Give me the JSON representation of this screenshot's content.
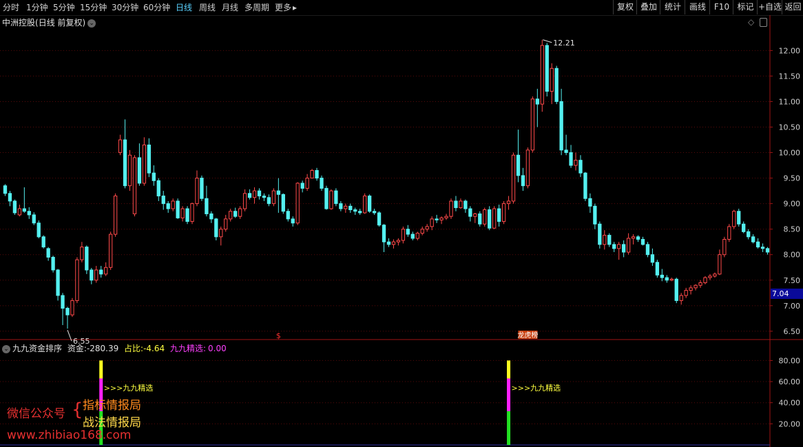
{
  "toolbar": {
    "tabs": [
      "分时",
      "1分钟",
      "5分钟",
      "15分钟",
      "30分钟",
      "60分钟",
      "日线",
      "周线",
      "月线",
      "多周期",
      "更多"
    ],
    "active_tab": "日线",
    "right_buttons": [
      "复权",
      "叠加",
      "统计",
      "画线",
      "F10",
      "标记",
      "+自选",
      "返回"
    ]
  },
  "chart_header": {
    "stock_name": "中洲控股",
    "period": "(日线 前复权)"
  },
  "indicator_header": {
    "name": "九九资金排序",
    "fund_label": "资金:",
    "fund_value": "-280.39",
    "ratio_label": "占比:",
    "ratio_value": "-4.64",
    "select_label": "九九精选:",
    "select_value": "0.00"
  },
  "price_marker": "7.04",
  "markers": {
    "dollar": "$",
    "rank": "龙虎榜",
    "signal": ">>>九九精选"
  },
  "watermark": {
    "line1": "微信公众号",
    "line2a": "指标情报局",
    "line2b": "战法情报局",
    "url": "www.zhibiao168.com"
  },
  "colors": {
    "up": "#ff4a4a",
    "down": "#54f0f0",
    "axis": "#a01414",
    "grid": "#5a0a0a"
  },
  "chart_data": [
    {
      "type": "candlestick",
      "title": "中洲控股(日线 前复权)",
      "y_axis_ticks": [
        "12.00",
        "11.50",
        "11.00",
        "10.50",
        "10.00",
        "9.50",
        "9.00",
        "8.50",
        "8.00",
        "7.50",
        "7.00",
        "6.50"
      ],
      "ylim": [
        6.35,
        12.45
      ],
      "annotations": [
        {
          "label": "12.21",
          "value": 12.21
        },
        {
          "label": "6.55",
          "value": 6.55
        }
      ],
      "ohlc": [
        [
          9.35,
          9.38,
          9.15,
          9.2
        ],
        [
          9.2,
          9.25,
          8.95,
          9.05
        ],
        [
          9.05,
          9.08,
          8.78,
          8.82
        ],
        [
          8.78,
          8.98,
          8.75,
          8.9
        ],
        [
          8.9,
          9.32,
          8.82,
          8.85
        ],
        [
          8.85,
          8.93,
          8.7,
          8.78
        ],
        [
          8.78,
          8.83,
          8.58,
          8.62
        ],
        [
          8.62,
          8.67,
          8.32,
          8.35
        ],
        [
          8.35,
          8.38,
          8.12,
          8.15
        ],
        [
          8.12,
          8.15,
          7.88,
          7.95
        ],
        [
          7.95,
          7.98,
          7.65,
          7.7
        ],
        [
          7.7,
          7.72,
          7.1,
          7.2
        ],
        [
          7.2,
          7.25,
          6.62,
          6.95
        ],
        [
          6.95,
          6.98,
          6.55,
          6.82
        ],
        [
          6.82,
          7.15,
          6.78,
          7.1
        ],
        [
          7.1,
          7.95,
          7.05,
          7.9
        ],
        [
          7.9,
          8.25,
          7.85,
          8.15
        ],
        [
          8.15,
          8.18,
          7.62,
          7.7
        ],
        [
          7.7,
          7.74,
          7.42,
          7.5
        ],
        [
          7.5,
          7.78,
          7.45,
          7.7
        ],
        [
          7.7,
          7.78,
          7.55,
          7.62
        ],
        [
          7.62,
          7.85,
          7.58,
          7.75
        ],
        [
          7.75,
          8.45,
          7.7,
          8.4
        ],
        [
          8.4,
          9.2,
          8.35,
          9.15
        ],
        [
          10.0,
          10.35,
          9.95,
          10.25
        ],
        [
          10.25,
          10.65,
          9.3,
          9.35
        ],
        [
          9.35,
          10.05,
          9.25,
          9.95
        ],
        [
          8.8,
          9.95,
          8.75,
          9.9
        ],
        [
          9.9,
          10.18,
          9.35,
          9.4
        ],
        [
          9.4,
          10.3,
          9.35,
          10.15
        ],
        [
          10.15,
          10.28,
          9.52,
          9.6
        ],
        [
          9.6,
          9.75,
          9.35,
          9.45
        ],
        [
          9.45,
          9.5,
          9.05,
          9.15
        ],
        [
          9.15,
          9.25,
          8.88,
          9.0
        ],
        [
          9.0,
          9.05,
          8.82,
          8.9
        ],
        [
          8.9,
          9.1,
          8.85,
          9.05
        ],
        [
          9.05,
          9.1,
          8.7,
          8.72
        ],
        [
          8.72,
          8.95,
          8.65,
          8.9
        ],
        [
          8.9,
          8.95,
          8.6,
          8.65
        ],
        [
          8.65,
          9.02,
          8.6,
          9.0
        ],
        [
          9.0,
          9.65,
          8.95,
          9.5
        ],
        [
          9.5,
          9.55,
          9.05,
          9.1
        ],
        [
          9.1,
          9.35,
          8.75,
          8.8
        ],
        [
          8.8,
          8.85,
          8.62,
          8.7
        ],
        [
          8.7,
          8.72,
          8.28,
          8.35
        ],
        [
          8.35,
          8.55,
          8.18,
          8.5
        ],
        [
          8.5,
          8.78,
          8.45,
          8.7
        ],
        [
          8.7,
          8.9,
          8.65,
          8.85
        ],
        [
          8.85,
          8.92,
          8.72,
          8.75
        ],
        [
          8.75,
          8.95,
          8.7,
          8.9
        ],
        [
          8.9,
          9.28,
          8.85,
          9.2
        ],
        [
          9.2,
          9.28,
          9.08,
          9.12
        ],
        [
          9.12,
          9.32,
          9.0,
          9.25
        ],
        [
          9.25,
          9.3,
          9.08,
          9.15
        ],
        [
          9.15,
          9.2,
          9.05,
          9.12
        ],
        [
          9.12,
          9.18,
          8.95,
          9.0
        ],
        [
          9.0,
          9.3,
          8.95,
          9.25
        ],
        [
          9.25,
          9.5,
          8.82,
          9.18
        ],
        [
          9.18,
          9.2,
          8.8,
          8.85
        ],
        [
          8.85,
          8.9,
          8.65,
          8.7
        ],
        [
          8.7,
          8.75,
          8.55,
          8.62
        ],
        [
          8.62,
          9.42,
          8.58,
          9.4
        ],
        [
          9.4,
          9.45,
          9.22,
          9.3
        ],
        [
          9.3,
          9.58,
          9.25,
          9.5
        ],
        [
          9.5,
          9.68,
          9.52,
          9.65
        ],
        [
          9.65,
          9.7,
          9.45,
          9.5
        ],
        [
          9.5,
          9.55,
          9.25,
          9.3
        ],
        [
          9.3,
          9.35,
          8.88,
          8.9
        ],
        [
          8.9,
          9.28,
          8.88,
          9.25
        ],
        [
          9.25,
          9.3,
          8.95,
          9.0
        ],
        [
          9.0,
          9.05,
          8.85,
          8.9
        ],
        [
          8.9,
          9.0,
          8.82,
          8.95
        ],
        [
          8.95,
          9.0,
          8.82,
          8.88
        ],
        [
          8.88,
          8.92,
          8.78,
          8.85
        ],
        [
          8.85,
          8.9,
          8.78,
          8.82
        ],
        [
          8.82,
          9.2,
          8.8,
          9.15
        ],
        [
          9.15,
          9.18,
          8.82,
          8.85
        ],
        [
          8.85,
          8.9,
          8.78,
          8.82
        ],
        [
          8.82,
          8.85,
          8.55,
          8.58
        ],
        [
          8.58,
          8.6,
          8.05,
          8.25
        ],
        [
          8.25,
          8.32,
          8.15,
          8.2
        ],
        [
          8.2,
          8.3,
          8.12,
          8.25
        ],
        [
          8.25,
          8.32,
          8.18,
          8.28
        ],
        [
          8.28,
          8.55,
          8.22,
          8.5
        ],
        [
          8.5,
          8.58,
          8.35,
          8.4
        ],
        [
          8.4,
          8.45,
          8.28,
          8.32
        ],
        [
          8.32,
          8.45,
          8.28,
          8.42
        ],
        [
          8.42,
          8.55,
          8.38,
          8.5
        ],
        [
          8.5,
          8.6,
          8.45,
          8.55
        ],
        [
          8.55,
          8.75,
          8.48,
          8.7
        ],
        [
          8.7,
          8.78,
          8.62,
          8.68
        ],
        [
          8.68,
          8.75,
          8.6,
          8.72
        ],
        [
          8.72,
          8.8,
          8.68,
          8.75
        ],
        [
          8.75,
          9.1,
          8.7,
          9.05
        ],
        [
          9.05,
          9.15,
          8.85,
          8.92
        ],
        [
          8.92,
          9.1,
          8.9,
          9.05
        ],
        [
          9.05,
          9.08,
          8.82,
          8.9
        ],
        [
          8.9,
          8.95,
          8.65,
          8.75
        ],
        [
          8.75,
          8.82,
          8.62,
          8.8
        ],
        [
          8.8,
          8.85,
          8.55,
          8.6
        ],
        [
          8.6,
          8.92,
          8.55,
          8.88
        ],
        [
          8.88,
          8.95,
          8.48,
          8.52
        ],
        [
          8.52,
          8.95,
          8.5,
          8.9
        ],
        [
          8.9,
          8.98,
          8.55,
          8.65
        ],
        [
          8.65,
          9.05,
          8.6,
          9.0
        ],
        [
          9.0,
          9.15,
          8.88,
          9.05
        ],
        [
          9.05,
          10.0,
          9.0,
          9.95
        ],
        [
          9.95,
          10.45,
          9.42,
          9.55
        ],
        [
          9.55,
          9.7,
          9.25,
          9.35
        ],
        [
          9.35,
          10.1,
          9.3,
          10.05
        ],
        [
          10.05,
          11.1,
          10.0,
          11.05
        ],
        [
          11.05,
          11.25,
          10.5,
          10.95
        ],
        [
          10.95,
          12.21,
          10.8,
          12.1
        ],
        [
          12.1,
          12.15,
          11.1,
          11.2
        ],
        [
          11.2,
          11.75,
          10.95,
          11.65
        ],
        [
          11.65,
          11.7,
          10.95,
          11.0
        ],
        [
          11.0,
          11.25,
          9.95,
          10.05
        ],
        [
          10.05,
          10.35,
          9.95,
          10.0
        ],
        [
          10.0,
          10.15,
          9.7,
          9.75
        ],
        [
          9.75,
          10.0,
          9.65,
          9.85
        ],
        [
          9.85,
          9.95,
          9.52,
          9.6
        ],
        [
          9.6,
          9.62,
          9.05,
          9.1
        ],
        [
          9.1,
          9.2,
          8.82,
          8.95
        ],
        [
          8.95,
          9.0,
          8.5,
          8.6
        ],
        [
          8.6,
          8.65,
          8.12,
          8.2
        ],
        [
          8.2,
          8.48,
          8.1,
          8.38
        ],
        [
          8.38,
          8.42,
          8.15,
          8.2
        ],
        [
          8.2,
          8.25,
          8.05,
          8.12
        ],
        [
          8.12,
          8.25,
          7.9,
          8.2
        ],
        [
          8.2,
          8.28,
          7.95,
          8.05
        ],
        [
          8.05,
          8.42,
          8.0,
          8.32
        ],
        [
          8.32,
          8.4,
          8.2,
          8.35
        ],
        [
          8.35,
          8.38,
          8.25,
          8.3
        ],
        [
          8.3,
          8.35,
          8.18,
          8.2
        ],
        [
          8.2,
          8.25,
          7.95,
          8.0
        ],
        [
          8.0,
          8.12,
          7.78,
          7.85
        ],
        [
          7.85,
          7.9,
          7.55,
          7.6
        ],
        [
          7.6,
          7.72,
          7.48,
          7.55
        ],
        [
          7.55,
          7.6,
          7.45,
          7.5
        ],
        [
          7.5,
          7.55,
          7.48,
          7.52
        ],
        [
          7.52,
          7.55,
          7.05,
          7.1
        ],
        [
          7.1,
          7.25,
          7.02,
          7.2
        ],
        [
          7.2,
          7.35,
          7.15,
          7.3
        ],
        [
          7.3,
          7.4,
          7.22,
          7.35
        ],
        [
          7.35,
          7.42,
          7.3,
          7.4
        ],
        [
          7.4,
          7.5,
          7.35,
          7.45
        ],
        [
          7.45,
          7.58,
          7.42,
          7.55
        ],
        [
          7.55,
          7.62,
          7.5,
          7.58
        ],
        [
          7.58,
          7.65,
          7.55,
          7.62
        ],
        [
          7.62,
          8.1,
          7.6,
          8.0
        ],
        [
          8.0,
          8.35,
          7.95,
          8.3
        ],
        [
          8.3,
          8.6,
          8.25,
          8.55
        ],
        [
          8.55,
          8.88,
          8.5,
          8.85
        ],
        [
          8.85,
          8.9,
          8.55,
          8.6
        ],
        [
          8.6,
          8.65,
          8.42,
          8.45
        ],
        [
          8.45,
          8.5,
          8.3,
          8.35
        ],
        [
          8.35,
          8.4,
          8.22,
          8.25
        ],
        [
          8.25,
          8.32,
          8.12,
          8.15
        ],
        [
          8.15,
          8.22,
          8.05,
          8.12
        ],
        [
          8.12,
          8.15,
          8.0,
          8.05
        ]
      ]
    },
    {
      "type": "bar",
      "title": "九九资金排序",
      "y_axis_ticks": [
        "80.00",
        "60.00",
        "40.00",
        "20.00"
      ],
      "ylim": [
        0,
        92
      ],
      "signals": [
        {
          "at_index": 20,
          "segments": [
            {
              "color": "green",
              "from": 0,
              "to": 32
            },
            {
              "color": "magenta",
              "from": 32,
              "to": 63
            },
            {
              "color": "yellow",
              "from": 63,
              "to": 80
            }
          ]
        },
        {
          "at_index": 105,
          "segments": [
            {
              "color": "green",
              "from": 0,
              "to": 32
            },
            {
              "color": "magenta",
              "from": 32,
              "to": 63
            },
            {
              "color": "yellow",
              "from": 63,
              "to": 80
            }
          ]
        }
      ]
    }
  ]
}
